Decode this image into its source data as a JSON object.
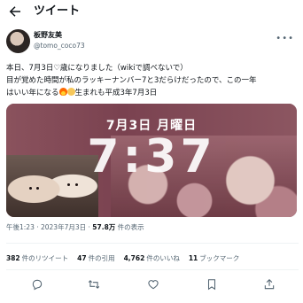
{
  "header": {
    "title": "ツイート"
  },
  "author": {
    "name": "板野友美",
    "handle": "@tomo_coco73"
  },
  "tweet": {
    "line1": "本日、7月3日♡歳になりました（wikiで調べないで）",
    "line2": "目が覚めた時間が私のラッキーナンバー7と3だらけだったので、この一年",
    "line3_a": "はいい年になる",
    "line3_b": "生まれも平成3年7月3日"
  },
  "media": {
    "date_text": "7月3日 月曜日",
    "time_text": "7:37"
  },
  "meta": {
    "timestamp": "午後1:23 · 2023年7月3日 · ",
    "views_count": "57.8万",
    "views_label": " 件の表示"
  },
  "stats": {
    "retweets_count": "382",
    "retweets_label": "件のリツイート",
    "quotes_count": "47",
    "quotes_label": "件の引用",
    "likes_count": "4,762",
    "likes_label": "件のいいね",
    "bookmarks_count": "11",
    "bookmarks_label": "ブックマーク"
  },
  "colors": {
    "text": "#0f1419",
    "secondary": "#536471",
    "divider": "#eff3f4",
    "media_bg": "#7e4a55"
  },
  "icons": [
    "back-arrow-icon",
    "more-icon",
    "fire-emoji-icon",
    "smile-emoji-icon",
    "reply-icon",
    "retweet-icon",
    "like-icon",
    "bookmark-icon",
    "share-icon"
  ]
}
